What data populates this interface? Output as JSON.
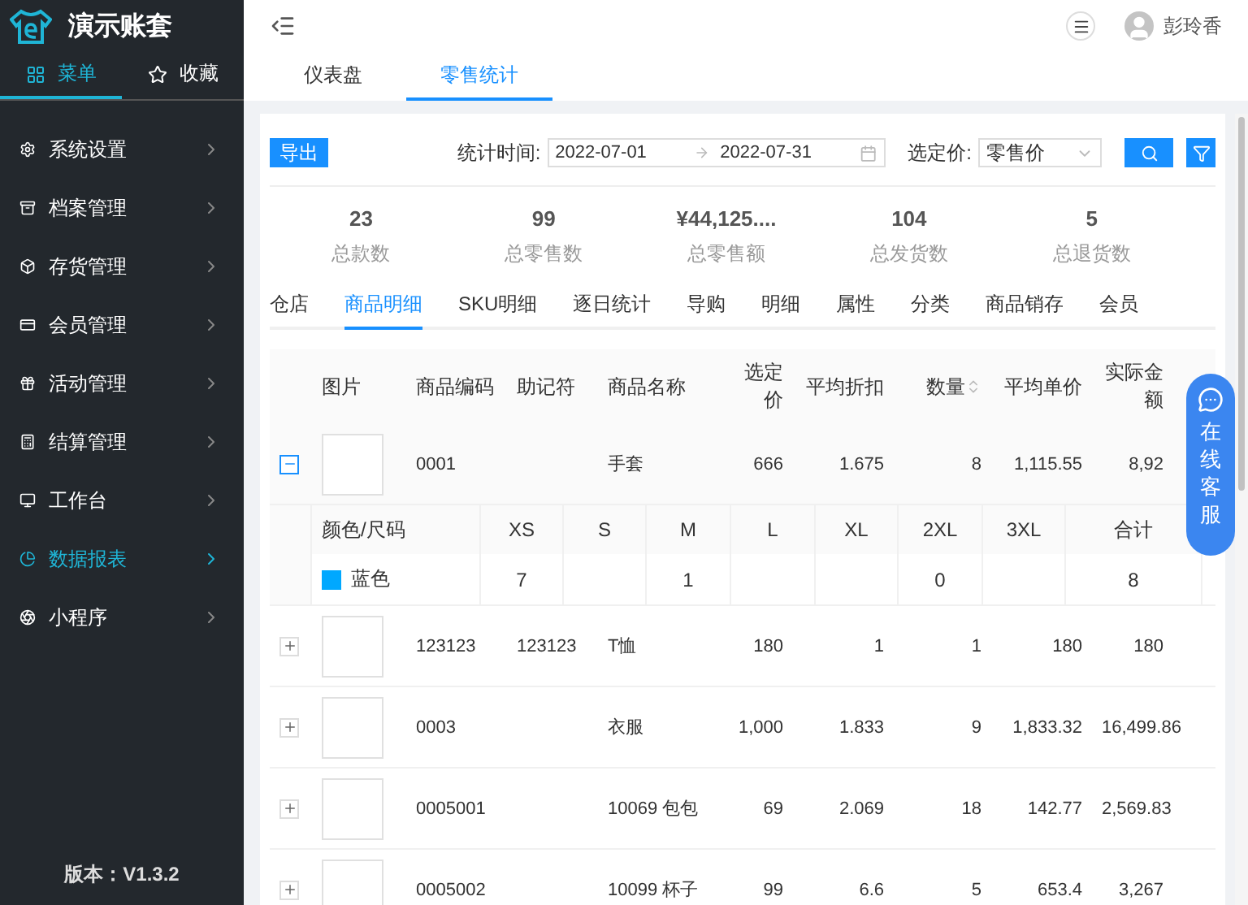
{
  "sidebar": {
    "logo_text": "演示账套",
    "tabs": [
      {
        "label": "菜单",
        "selected": true
      },
      {
        "label": "收藏",
        "selected": false
      }
    ],
    "menu": [
      {
        "label": "系统设置",
        "selected": false
      },
      {
        "label": "档案管理",
        "selected": false
      },
      {
        "label": "存货管理",
        "selected": false
      },
      {
        "label": "会员管理",
        "selected": false
      },
      {
        "label": "活动管理",
        "selected": false
      },
      {
        "label": "结算管理",
        "selected": false
      },
      {
        "label": "工作台",
        "selected": false
      },
      {
        "label": "数据报表",
        "selected": true
      },
      {
        "label": "小程序",
        "selected": false
      }
    ],
    "version": "版本：V1.3.2"
  },
  "header": {
    "user": "彭玲香"
  },
  "page_tabs": [
    {
      "label": "仪表盘",
      "selected": false
    },
    {
      "label": "零售统计",
      "selected": true
    }
  ],
  "toolbar": {
    "export_label": "导出",
    "date_label": "统计时间:",
    "date_start": "2022-07-01",
    "date_end": "2022-07-31",
    "price_label": "选定价:",
    "price_value": "零售价"
  },
  "stats": [
    {
      "value": "23",
      "label": "总款数"
    },
    {
      "value": "99",
      "label": "总零售数"
    },
    {
      "value": "¥44,125....",
      "label": "总零售额"
    },
    {
      "value": "104",
      "label": "总发货数"
    },
    {
      "value": "5",
      "label": "总退货数"
    }
  ],
  "sub_tabs": [
    {
      "label": "仓店",
      "selected": false
    },
    {
      "label": "商品明细",
      "selected": true
    },
    {
      "label": "SKU明细",
      "selected": false
    },
    {
      "label": "逐日统计",
      "selected": false
    },
    {
      "label": "导购",
      "selected": false
    },
    {
      "label": "明细",
      "selected": false
    },
    {
      "label": "属性",
      "selected": false
    },
    {
      "label": "分类",
      "selected": false
    },
    {
      "label": "商品销存",
      "selected": false
    },
    {
      "label": "会员",
      "selected": false
    }
  ],
  "table": {
    "columns": [
      "图片",
      "商品编码",
      "助记符",
      "商品名称",
      "选定价",
      "平均折扣",
      "数量",
      "平均单价",
      "实际金额"
    ],
    "rows": [
      {
        "expanded": true,
        "code": "0001",
        "mnemonic": "",
        "name": "手套",
        "price": "666",
        "discount": "1.675",
        "qty": "8",
        "unit": "1,115.55",
        "amount": "8,92"
      },
      {
        "expanded": false,
        "code": "123123",
        "mnemonic": "123123",
        "name": "T恤",
        "price": "180",
        "discount": "1",
        "qty": "1",
        "unit": "180",
        "amount": "180"
      },
      {
        "expanded": false,
        "code": "0003",
        "mnemonic": "",
        "name": "衣服",
        "price": "1,000",
        "discount": "1.833",
        "qty": "9",
        "unit": "1,833.32",
        "amount": "16,499.86"
      },
      {
        "expanded": false,
        "code": "0005001",
        "mnemonic": "",
        "name": "10069 包包",
        "price": "69",
        "discount": "2.069",
        "qty": "18",
        "unit": "142.77",
        "amount": "2,569.83"
      },
      {
        "expanded": false,
        "code": "0005002",
        "mnemonic": "",
        "name": "10099 杯子",
        "price": "99",
        "discount": "6.6",
        "qty": "5",
        "unit": "653.4",
        "amount": "3,267"
      }
    ]
  },
  "detail": {
    "first_header": "颜色/尺码",
    "total_header": "合计",
    "color": "#00a8ff",
    "color_name": "蓝色",
    "total": "8",
    "sizes": [
      {
        "label": "XS",
        "count": "7"
      },
      {
        "label": "S"
      },
      {
        "label": "M",
        "count": "1"
      },
      {
        "label": "L"
      },
      {
        "label": "XL"
      },
      {
        "label": "2XL",
        "count": "0"
      },
      {
        "label": "3XL"
      }
    ]
  },
  "chat": {
    "label": "在线客服"
  }
}
